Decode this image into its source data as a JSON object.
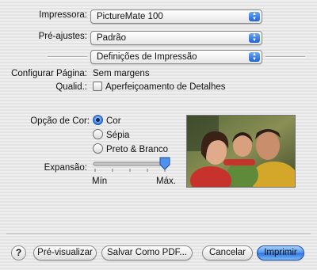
{
  "printer": {
    "label": "Impressora:",
    "value": "PictureMate 100"
  },
  "presets": {
    "label": "Pré-ajustes:",
    "value": "Padrão"
  },
  "panel": {
    "value": "Definições de Impressão"
  },
  "page_setup": {
    "label": "Configurar Página:",
    "value": "Sem margens"
  },
  "quality": {
    "label": "Qualid.:",
    "checkbox_label": "Aperfeiçoamento de Detalhes",
    "checked": false
  },
  "color_option": {
    "label": "Opção de Cor:",
    "options": [
      {
        "label": "Cor",
        "selected": true
      },
      {
        "label": "Sépia",
        "selected": false
      },
      {
        "label": "Preto & Branco",
        "selected": false
      }
    ]
  },
  "expansion": {
    "label": "Expansão:",
    "min_label": "Mín",
    "max_label": "Máx.",
    "level": 1.0
  },
  "buttons": {
    "help": "?",
    "preview": "Pré-visualizar",
    "save_pdf": "Salvar Como PDF...",
    "cancel": "Cancelar",
    "print": "Imprimir"
  },
  "icons": {
    "popup_arrows": "up-down-arrows-icon",
    "help": "help-icon"
  },
  "colors": {
    "accent": "#2b72dc",
    "background": "#ececec"
  }
}
